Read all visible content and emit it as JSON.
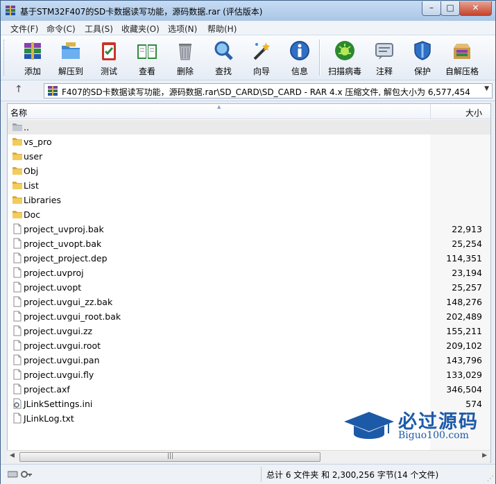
{
  "window": {
    "title": "基于STM32F407的SD卡数据读写功能，源码数据.rar (评估版本)",
    "controls": {
      "minimize": "–",
      "maximize": "□",
      "close": "✕"
    }
  },
  "menu": [
    "文件(F)",
    "命令(C)",
    "工具(S)",
    "收藏夹(O)",
    "选项(N)",
    "帮助(H)"
  ],
  "toolbar": [
    {
      "label": "添加",
      "icon": "add-archive-icon"
    },
    {
      "label": "解压到",
      "icon": "extract-folder-icon"
    },
    {
      "label": "测试",
      "icon": "test-clipboard-icon"
    },
    {
      "label": "查看",
      "icon": "view-book-icon"
    },
    {
      "label": "删除",
      "icon": "trash-icon"
    },
    {
      "label": "查找",
      "icon": "magnifier-icon"
    },
    {
      "label": "向导",
      "icon": "wizard-wand-icon"
    },
    {
      "label": "信息",
      "icon": "info-icon"
    },
    {
      "label": "扫描病毒",
      "icon": "virus-scan-icon"
    },
    {
      "label": "注释",
      "icon": "comment-icon"
    },
    {
      "label": "保护",
      "icon": "shield-icon"
    },
    {
      "label": "自解压格",
      "icon": "sfx-box-icon"
    }
  ],
  "path": {
    "text": "F407的SD卡数据读写功能，源码数据.rar\\SD_CARD\\SD_CARD - RAR 4.x 压缩文件, 解包大小为 6,577,454 字节"
  },
  "columns": {
    "name": "名称",
    "size": "大小"
  },
  "files": [
    {
      "name": "..",
      "size": "",
      "type": "folder"
    },
    {
      "name": "vs_pro",
      "size": "",
      "type": "folder"
    },
    {
      "name": "user",
      "size": "",
      "type": "folder"
    },
    {
      "name": "Obj",
      "size": "",
      "type": "folder"
    },
    {
      "name": "List",
      "size": "",
      "type": "folder"
    },
    {
      "name": "Libraries",
      "size": "",
      "type": "folder"
    },
    {
      "name": "Doc",
      "size": "",
      "type": "folder"
    },
    {
      "name": "project_uvproj.bak",
      "size": "22,913",
      "type": "file"
    },
    {
      "name": "project_uvopt.bak",
      "size": "25,254",
      "type": "file"
    },
    {
      "name": "project_project.dep",
      "size": "114,351",
      "type": "file"
    },
    {
      "name": "project.uvproj",
      "size": "23,194",
      "type": "file"
    },
    {
      "name": "project.uvopt",
      "size": "25,257",
      "type": "file"
    },
    {
      "name": "project.uvgui_zz.bak",
      "size": "148,276",
      "type": "file"
    },
    {
      "name": "project.uvgui_root.bak",
      "size": "202,489",
      "type": "file"
    },
    {
      "name": "project.uvgui.zz",
      "size": "155,211",
      "type": "file"
    },
    {
      "name": "project.uvgui.root",
      "size": "209,102",
      "type": "file"
    },
    {
      "name": "project.uvgui.pan",
      "size": "143,796",
      "type": "file"
    },
    {
      "name": "project.uvgui.fly",
      "size": "133,029",
      "type": "file"
    },
    {
      "name": "project.axf",
      "size": "346,504",
      "type": "file"
    },
    {
      "name": "JLinkSettings.ini",
      "size": "574",
      "type": "ini"
    },
    {
      "name": "JLinkLog.txt",
      "size": "",
      "type": "file"
    }
  ],
  "status": {
    "text": "总计 6 文件夹 和 2,300,256 字节(14 个文件)"
  },
  "watermark": {
    "brand": "必过源码",
    "site": "Biguo100.com"
  }
}
